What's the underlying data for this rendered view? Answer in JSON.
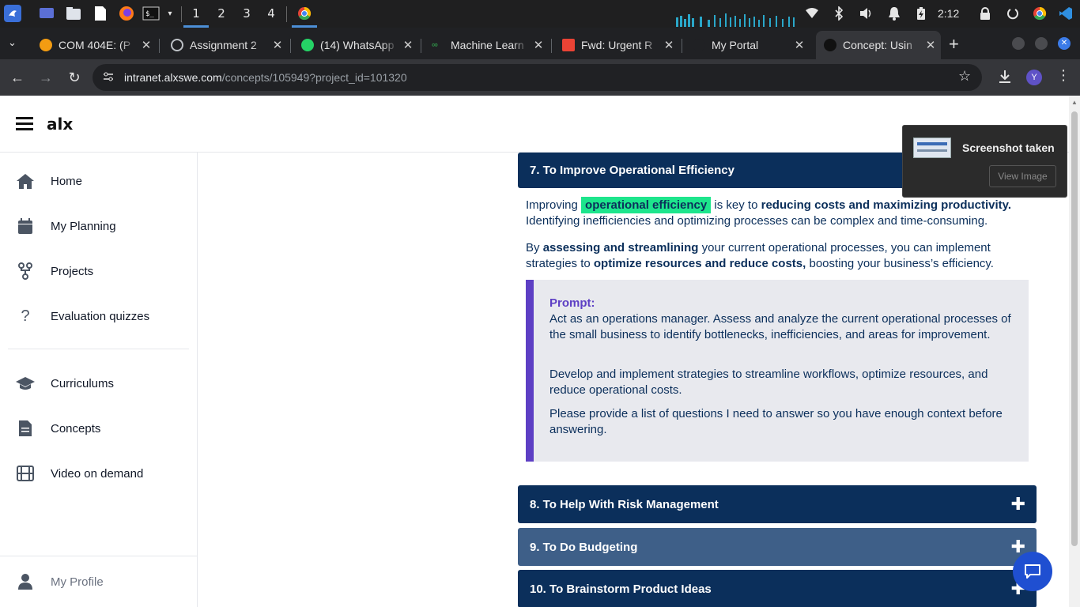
{
  "taskbar": {
    "workspaces": [
      "1",
      "2",
      "3",
      "4"
    ],
    "active_workspace": "1",
    "clock": "2:12",
    "icons": [
      "app-menu-icon",
      "files-icon",
      "document-icon",
      "firefox-icon",
      "terminal-icon",
      "chrome-icon",
      "wifi-icon",
      "bluetooth-icon",
      "volume-icon",
      "bell-icon",
      "battery-icon",
      "lock-icon",
      "power-icon",
      "vscode-icon"
    ]
  },
  "tabs": [
    {
      "title": "COM 404E: (P",
      "active": false
    },
    {
      "title": "Assignment 2",
      "active": false
    },
    {
      "title": "(14) WhatsApp",
      "active": false
    },
    {
      "title": "Machine Learn",
      "active": false
    },
    {
      "title": "Fwd: Urgent R",
      "active": false
    },
    {
      "title": "My Portal",
      "active": false
    },
    {
      "title": "Concept: Usin",
      "active": true
    }
  ],
  "browser": {
    "url_host": "intranet.alxswe.com",
    "url_path": "/concepts/105949?project_id=101320",
    "profile_initial": "Y"
  },
  "app": {
    "logo": "alx"
  },
  "sidebar": {
    "items": [
      {
        "label": "Home",
        "icon": "home-icon"
      },
      {
        "label": "My Planning",
        "icon": "calendar-icon"
      },
      {
        "label": "Projects",
        "icon": "projects-icon"
      },
      {
        "label": "Evaluation quizzes",
        "icon": "question-icon"
      },
      {
        "label": "Curriculums",
        "icon": "graduation-cap-icon"
      },
      {
        "label": "Concepts",
        "icon": "document-icon"
      },
      {
        "label": "Video on demand",
        "icon": "film-icon"
      }
    ],
    "profile_label": "My Profile"
  },
  "content": {
    "section7_title": "7. To Improve Operational Efficiency",
    "p1_a": "Improving ",
    "p1_hl": "operational efficiency",
    "p1_b": " is key to ",
    "p1_bold": "reducing costs and maximizing productivity.",
    "p1_c": " Identifying inefficiencies and optimizing processes can be complex and time-consuming.",
    "p2_a": "By ",
    "p2_bold1": "assessing and streamlining",
    "p2_b": " your current operational processes, you can implement strategies to ",
    "p2_bold2": "optimize resources and reduce costs,",
    "p2_c": " boosting your business’s efficiency.",
    "prompt_label": "Prompt:",
    "prompt_p1": "Act as an operations manager. Assess and analyze the current operational processes of the small business to identify bottlenecks, inefficiencies, and areas for improvement.",
    "prompt_p2": "Develop and implement strategies to streamline workflows, optimize resources, and reduce operational costs.",
    "prompt_p3": "Please provide a list of questions I need to answer so you have enough context before answering.",
    "section8_title": "8. To Help With Risk Management",
    "section9_title": "9. To Do Budgeting",
    "section10_title": "10. To Brainstorm Product Ideas"
  },
  "notification": {
    "title": "Screenshot taken",
    "action": "View Image"
  },
  "colors": {
    "accent_navy": "#0b2f5b",
    "highlight_green": "#1de58c",
    "prompt_border": "#5d3fc4",
    "chat_blue": "#1f4fd1"
  }
}
